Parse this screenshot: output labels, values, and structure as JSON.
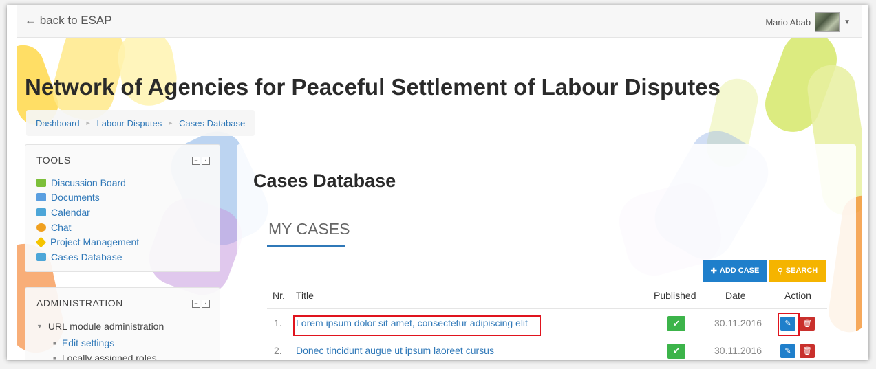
{
  "topbar": {
    "back_label": "← back to ESAP",
    "user_name": "Mario Abab",
    "user_caret": "▼"
  },
  "site": {
    "title": "Network of Agencies for Peaceful Settlement of Labour Disputes"
  },
  "breadcrumb": {
    "items": [
      "Dashboard",
      "Labour Disputes",
      "Cases Database"
    ],
    "separator": "►"
  },
  "tools_block": {
    "title": "TOOLS",
    "items": [
      {
        "label": "Discussion Board",
        "icon": "discussion-board-icon",
        "color": "#7cbf3a"
      },
      {
        "label": "Documents",
        "icon": "folder-icon",
        "color": "#5a9fe0"
      },
      {
        "label": "Calendar",
        "icon": "calendar-icon",
        "color": "#4da6d8"
      },
      {
        "label": "Chat",
        "icon": "chat-icon",
        "color": "#f0a020"
      },
      {
        "label": "Project Management",
        "icon": "project-management-icon",
        "color": "#f5c400"
      },
      {
        "label": "Cases Database",
        "icon": "database-icon",
        "color": "#4da6d8"
      }
    ]
  },
  "admin_block": {
    "title": "ADMINISTRATION",
    "section_label": "URL module administration",
    "edit_settings_label": "Edit settings",
    "cut_off_item": "Locally assigned roles"
  },
  "main": {
    "heading": "Cases Database",
    "tab_label": "MY CASES",
    "add_case_label": "ADD CASE",
    "search_label": "SEARCH",
    "table": {
      "headers": {
        "nr": "Nr.",
        "title": "Title",
        "published": "Published",
        "date": "Date",
        "action": "Action"
      },
      "rows": [
        {
          "nr": "1.",
          "title": "Lorem ipsum dolor sit amet, consectetur adipiscing elit",
          "date": "30.11.2016"
        },
        {
          "nr": "2.",
          "title": "Donec tincidunt augue ut ipsum laoreet cursus",
          "date": "30.11.2016"
        }
      ]
    }
  },
  "colors": {
    "accent_blue": "#1f7fcb",
    "search_yellow": "#f5b400",
    "published_green": "#3cb44a",
    "delete_red": "#c9302c",
    "highlight_red": "#e0141e"
  }
}
